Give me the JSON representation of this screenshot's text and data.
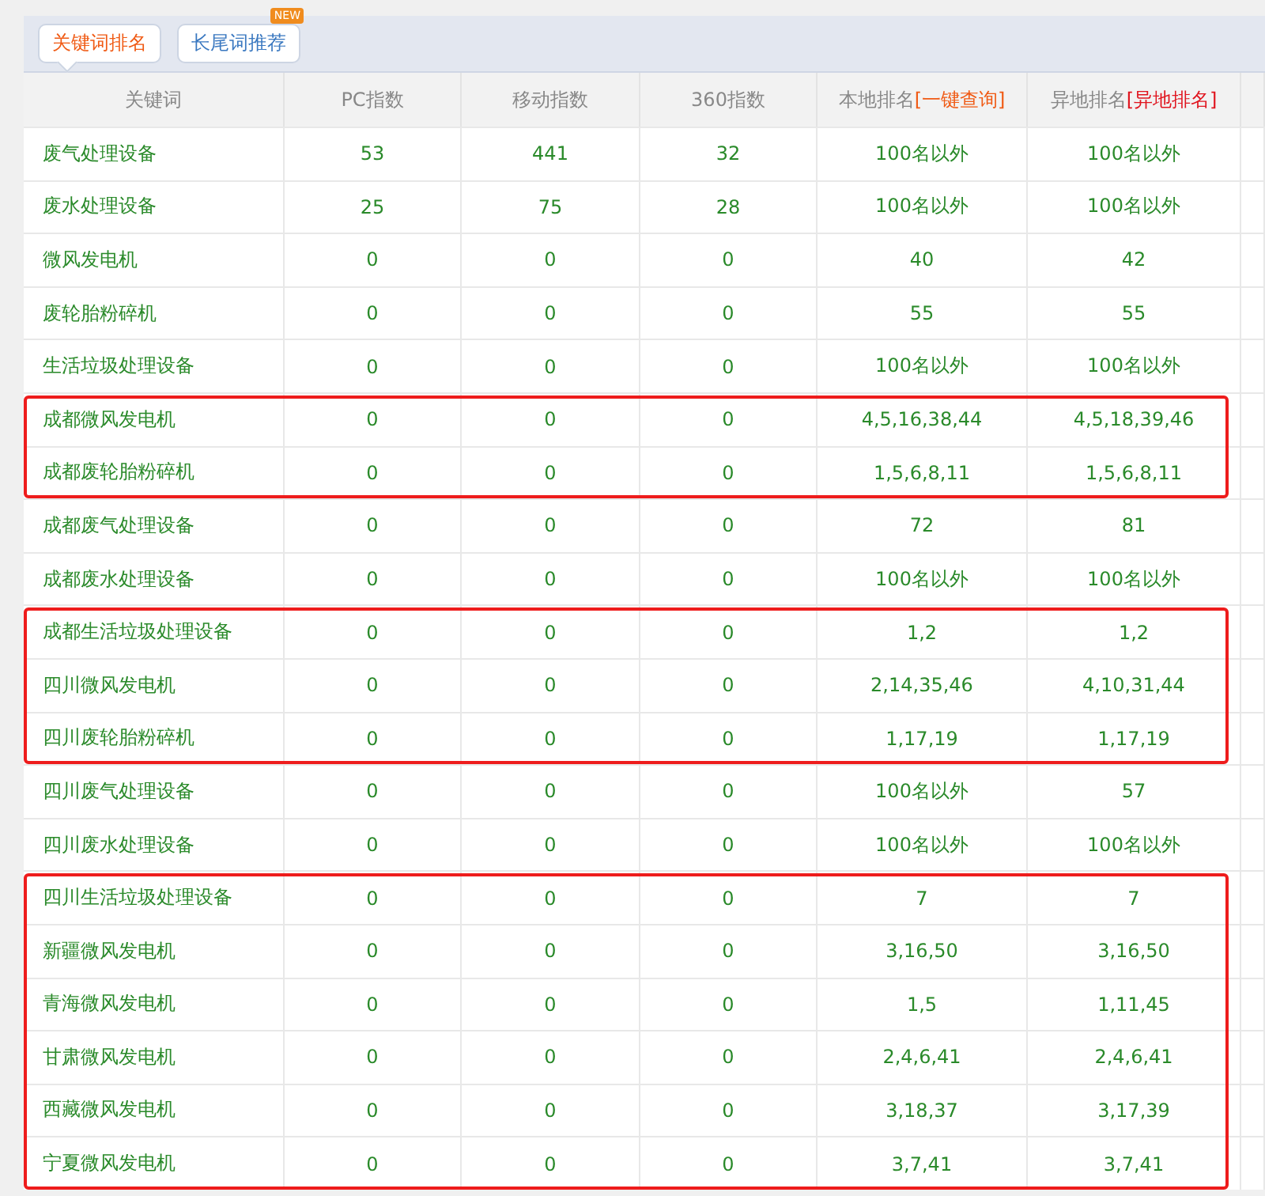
{
  "tabs": [
    {
      "label": "关键词排名",
      "selected": true
    },
    {
      "label": "长尾词推荐",
      "selected": false,
      "badge": "NEW"
    }
  ],
  "table": {
    "columns": [
      {
        "label": "关键词"
      },
      {
        "label": "PC指数"
      },
      {
        "label": "移动指数"
      },
      {
        "label": "360指数"
      },
      {
        "label": "本地排名",
        "link": "[一键查询]"
      },
      {
        "label": "异地排名",
        "link": "[异地排名]"
      }
    ],
    "rows": [
      {
        "cells": [
          "废气处理设备",
          "53",
          "441",
          "32",
          "100名以外",
          "100名以外"
        ],
        "boxed": false
      },
      {
        "cells": [
          "废水处理设备",
          "25",
          "75",
          "28",
          "100名以外",
          "100名以外"
        ],
        "boxed": false
      },
      {
        "cells": [
          "微风发电机",
          "0",
          "0",
          "0",
          "40",
          "42"
        ],
        "boxed": false
      },
      {
        "cells": [
          "废轮胎粉碎机",
          "0",
          "0",
          "0",
          "55",
          "55"
        ],
        "boxed": false
      },
      {
        "cells": [
          "生活垃圾处理设备",
          "0",
          "0",
          "0",
          "100名以外",
          "100名以外"
        ],
        "boxed": false
      },
      {
        "cells": [
          "成都微风发电机",
          "0",
          "0",
          "0",
          "4,5,16,38,44",
          "4,5,18,39,46"
        ],
        "boxed": true
      },
      {
        "cells": [
          "成都废轮胎粉碎机",
          "0",
          "0",
          "0",
          "1,5,6,8,11",
          "1,5,6,8,11"
        ],
        "boxed": true
      },
      {
        "cells": [
          "成都废气处理设备",
          "0",
          "0",
          "0",
          "72",
          "81"
        ],
        "boxed": false
      },
      {
        "cells": [
          "成都废水处理设备",
          "0",
          "0",
          "0",
          "100名以外",
          "100名以外"
        ],
        "boxed": false
      },
      {
        "cells": [
          "成都生活垃圾处理设备",
          "0",
          "0",
          "0",
          "1,2",
          "1,2"
        ],
        "boxed": true
      },
      {
        "cells": [
          "四川微风发电机",
          "0",
          "0",
          "0",
          "2,14,35,46",
          "4,10,31,44"
        ],
        "boxed": true
      },
      {
        "cells": [
          "四川废轮胎粉碎机",
          "0",
          "0",
          "0",
          "1,17,19",
          "1,17,19"
        ],
        "boxed": true
      },
      {
        "cells": [
          "四川废气处理设备",
          "0",
          "0",
          "0",
          "100名以外",
          "57"
        ],
        "boxed": false
      },
      {
        "cells": [
          "四川废水处理设备",
          "0",
          "0",
          "0",
          "100名以外",
          "100名以外"
        ],
        "boxed": false
      },
      {
        "cells": [
          "四川生活垃圾处理设备",
          "0",
          "0",
          "0",
          "7",
          "7"
        ],
        "boxed": true
      },
      {
        "cells": [
          "新疆微风发电机",
          "0",
          "0",
          "0",
          "3,16,50",
          "3,16,50"
        ],
        "boxed": true
      },
      {
        "cells": [
          "青海微风发电机",
          "0",
          "0",
          "0",
          "1,5",
          "1,11,45"
        ],
        "boxed": true
      },
      {
        "cells": [
          "甘肃微风发电机",
          "0",
          "0",
          "0",
          "2,4,6,41",
          "2,4,6,41"
        ],
        "boxed": true
      },
      {
        "cells": [
          "西藏微风发电机",
          "0",
          "0",
          "0",
          "3,18,37",
          "3,17,39"
        ],
        "boxed": true
      },
      {
        "cells": [
          "宁夏微风发电机",
          "0",
          "0",
          "0",
          "3,7,41",
          "3,7,41"
        ],
        "boxed": true
      }
    ]
  }
}
